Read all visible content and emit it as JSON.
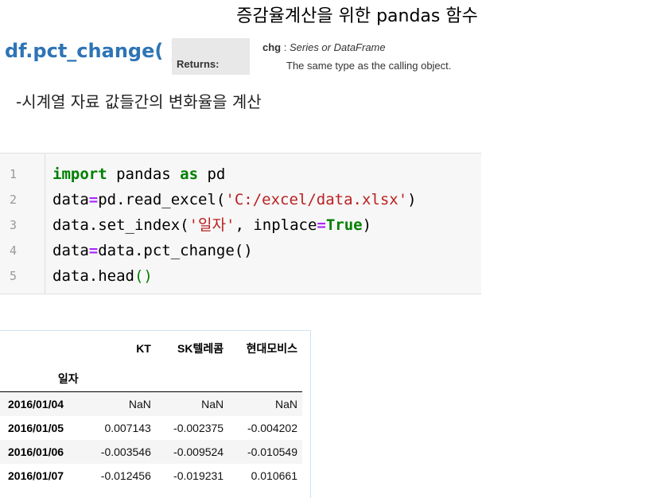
{
  "title": "증감율계산을 위한 pandas 함수",
  "function_name": "df.pct_change( )",
  "returns": {
    "label": "Returns:",
    "name": "chg",
    "separator": " : ",
    "type": "Series or DataFrame",
    "description": "The same type as the calling object."
  },
  "description": "-시계열 자료 값들간의 변화율을 계산",
  "code": {
    "line_numbers": [
      "1",
      "2",
      "3",
      "4",
      "5"
    ],
    "lines": [
      [
        "import",
        " pandas ",
        "as",
        " pd"
      ],
      [
        "data",
        "=",
        "pd.read_excel(",
        "'C:/excel/data.xlsx'",
        ")"
      ],
      [
        "data.set_index(",
        "'일자'",
        ", inplace",
        "=",
        "True",
        ")"
      ],
      [
        "data",
        "=",
        "data.pct_change()"
      ],
      [
        "data.head",
        "()"
      ]
    ]
  },
  "dataframe": {
    "columns": [
      "KT",
      "SK텔레콤",
      "현대모비스"
    ],
    "index_name": "일자",
    "rows": [
      {
        "index": "2016/01/04",
        "values": [
          "NaN",
          "NaN",
          "NaN"
        ]
      },
      {
        "index": "2016/01/05",
        "values": [
          "0.007143",
          "-0.002375",
          "-0.004202"
        ]
      },
      {
        "index": "2016/01/06",
        "values": [
          "-0.003546",
          "-0.009524",
          "-0.010549"
        ]
      },
      {
        "index": "2016/01/07",
        "values": [
          "-0.012456",
          "-0.019231",
          "0.010661"
        ]
      }
    ]
  }
}
